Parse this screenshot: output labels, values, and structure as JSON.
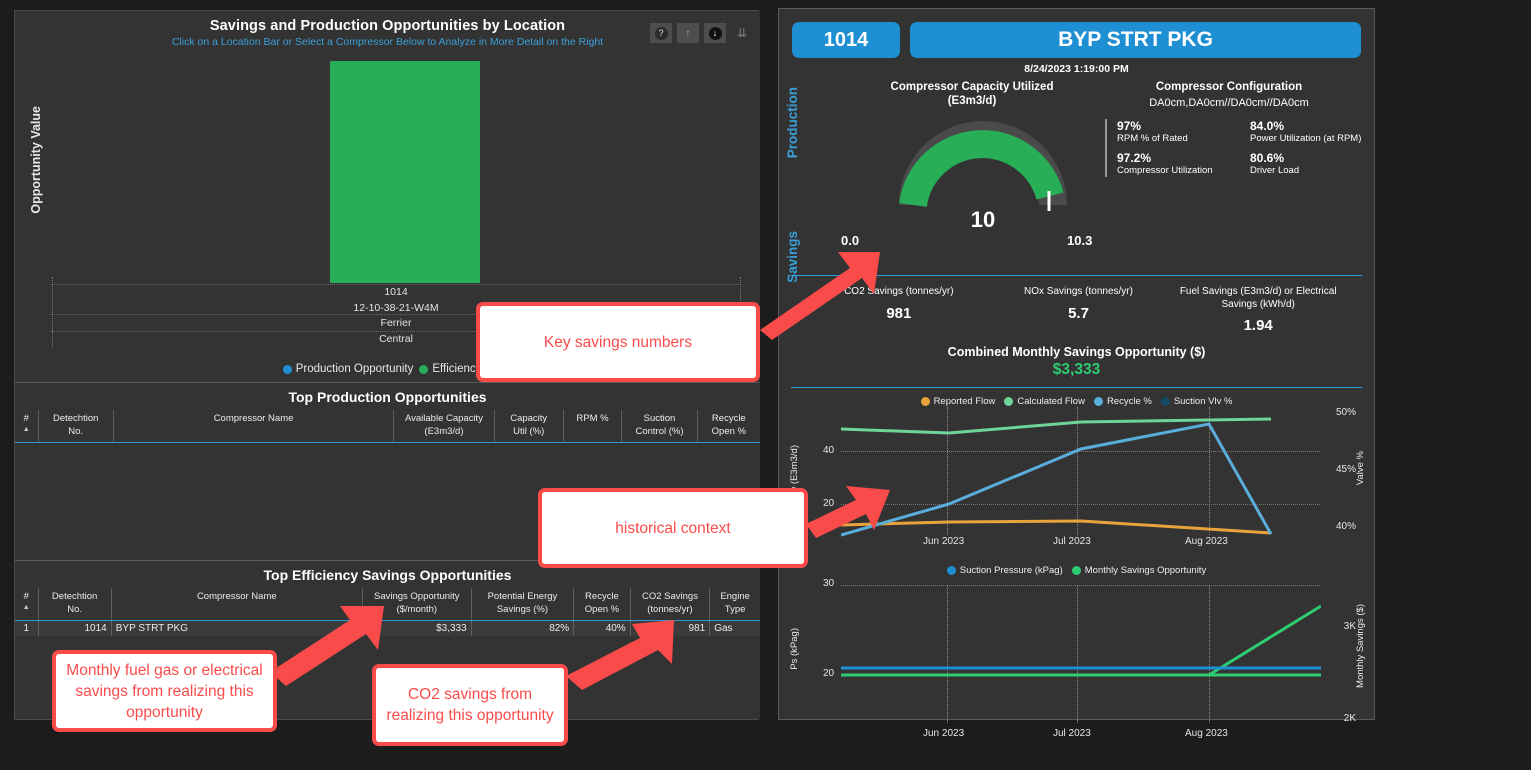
{
  "left_panel": {
    "chart_title": "Savings and Production Opportunities by Location",
    "chart_subtitle": "Click on a Location Bar or Select a Compressor Below to Analyze in More Detail on the Right",
    "y_axis_label": "Opportunity Value",
    "toolbar": {
      "help_icon": "help-icon",
      "up_icon": "arrow-up-icon",
      "down_icon": "arrow-down-filled-icon",
      "drill_icon": "double-arrow-down-icon"
    },
    "legend": [
      {
        "label": "Production Opportunity",
        "color": "#1f8fd4"
      },
      {
        "label": "Efficiency S",
        "color": "#27ae57"
      }
    ]
  },
  "chart_data": [
    {
      "type": "bar",
      "title": "Savings and Production Opportunities by Location",
      "subtitle": "Click on a Location Bar or Select a Compressor Below to Analyze in More Detail on the Right",
      "ylabel": "Opportunity Value",
      "xlabel": "",
      "categories": [
        "1014"
      ],
      "category_hierarchy": [
        "1014",
        "12-10-38-21-W4M",
        "Ferrier",
        "Central"
      ],
      "series": [
        {
          "name": "Production Opportunity",
          "color": "#1f8fd4",
          "values": [
            0
          ]
        },
        {
          "name": "Efficiency Savings",
          "color": "#27ae57",
          "values": [
            3333
          ]
        }
      ],
      "grid": true,
      "legend_position": "bottom"
    },
    {
      "type": "line",
      "title": "",
      "xlabel": "",
      "ylabel": "Flow (E3m3/d)",
      "y2label": "Valve %",
      "x": [
        "Jun 2023",
        "Jul 2023",
        "Aug 2023"
      ],
      "xtick_labels": [
        "Jun 2023",
        "Jul 2023",
        "Aug 2023"
      ],
      "ytick_labels": [
        "20",
        "40"
      ],
      "y2tick_labels": [
        "40%",
        "45%",
        "50%"
      ],
      "ylim": [
        0,
        50
      ],
      "y2lim": [
        38.5,
        51
      ],
      "series": [
        {
          "name": "Reported Flow",
          "color": "#e8a33d",
          "axis": "left",
          "values": [
            12.5,
            12.6,
            12.3,
            10.4
          ]
        },
        {
          "name": "Calculated Flow",
          "color": "#6fd49a",
          "axis": "left",
          "values": [
            45.5,
            45.0,
            46.5,
            47.0
          ]
        },
        {
          "name": "Recycle %",
          "color": "#5aaedb",
          "axis": "right",
          "values": [
            39.7,
            41.3,
            45.6,
            40.0
          ]
        },
        {
          "name": "Suction Vlv %",
          "color": "#124a63",
          "axis": "right",
          "values": []
        }
      ],
      "grid": true,
      "legend_position": "top"
    },
    {
      "type": "line",
      "title": "",
      "xlabel": "",
      "ylabel": "Ps (kPag)",
      "y2label": "Monthly Savings ($)",
      "x": [
        "Jun 2023",
        "Jul 2023",
        "Aug 2023"
      ],
      "xtick_labels": [
        "Jun 2023",
        "Jul 2023",
        "Aug 2023"
      ],
      "ytick_labels": [
        "20",
        "30"
      ],
      "y2tick_labels": [
        "2K",
        "3K"
      ],
      "ylim": [
        15,
        31
      ],
      "y2lim": [
        1900,
        3500
      ],
      "series": [
        {
          "name": "Suction Pressure (kPag)",
          "color": "#1f8fd4",
          "axis": "left",
          "values": [
            20.6,
            20.6,
            20.6,
            20.6
          ]
        },
        {
          "name": "Monthly Savings Opportunity",
          "color": "#2ecc71",
          "axis": "right",
          "values": [
            2000,
            2000,
            2000,
            3333
          ]
        }
      ],
      "grid": true,
      "legend_position": "top"
    }
  ],
  "production_table": {
    "title": "Top Production Opportunities",
    "columns": [
      "#",
      "Detechtion No.",
      "Compressor Name",
      "Available Capacity (E3m3/d)",
      "Capacity Util (%)",
      "RPM %",
      "Suction Control (%)",
      "Recycle Open %"
    ],
    "columns_split": [
      [
        "#",
        ""
      ],
      [
        "Detechtion",
        "No."
      ],
      [
        "Compressor Name",
        ""
      ],
      [
        "Available Capacity",
        "(E3m3/d)"
      ],
      [
        "Capacity",
        "Util (%)"
      ],
      [
        "RPM %",
        ""
      ],
      [
        "Suction",
        "Control (%)"
      ],
      [
        "Recycle",
        "Open %"
      ]
    ],
    "rows": []
  },
  "efficiency_table": {
    "title": "Top Efficiency Savings Opportunities",
    "columns_split": [
      [
        "#",
        ""
      ],
      [
        "Detechtion",
        "No."
      ],
      [
        "Compressor Name",
        ""
      ],
      [
        "Savings Opportunity",
        "($/month)"
      ],
      [
        "Potential Energy",
        "Savings (%)"
      ],
      [
        "Recycle",
        "Open %"
      ],
      [
        "CO2 Savings",
        "(tonnes/yr)"
      ],
      [
        "Engine",
        "Type"
      ]
    ],
    "rows": [
      {
        "index": "1",
        "detechtion_no": "1014",
        "compressor_name": "BYP STRT PKG",
        "savings_opportunity": "$3,333",
        "potential_energy_savings": "82%",
        "recycle_open": "40%",
        "co2_savings": "981",
        "engine_type": "Gas"
      }
    ]
  },
  "right_panel": {
    "id_pill": "1014",
    "name_pill": "BYP STRT PKG",
    "timestamp": "8/24/2023 1:19:00 PM",
    "section_production": "Production",
    "section_savings": "Savings",
    "gauge": {
      "title_line1": "Compressor Capacity Utilized",
      "title_line2": "(E3m3/d)",
      "min": "0.0",
      "max": "10.3",
      "value": "10",
      "color": "#27ae57"
    },
    "configuration": {
      "title": "Compressor Configuration",
      "value": "DA0cm,DA0cm//DA0cm//DA0cm",
      "metrics": [
        {
          "value": "97%",
          "label": "RPM % of Rated"
        },
        {
          "value": "84.0%",
          "label": "Power Utilization (at RPM)"
        },
        {
          "value": "97.2%",
          "label": "Compressor Utilization"
        },
        {
          "value": "80.6%",
          "label": "Driver Load"
        }
      ]
    },
    "savings": {
      "cells": [
        {
          "label": "CO2 Savings (tonnes/yr)",
          "value": "981"
        },
        {
          "label": "NOx Savings (tonnes/yr)",
          "value": "5.7"
        },
        {
          "label": "Fuel Savings (E3m3/d) or Electrical Savings (kWh/d)",
          "value": "1.94"
        }
      ],
      "combined_label": "Combined Monthly Savings Opportunity ($)",
      "combined_value": "$3,333",
      "combined_color": "#2ecc71"
    },
    "chart1_legend": [
      {
        "label": "Reported Flow",
        "color": "#e8a33d"
      },
      {
        "label": "Calculated Flow",
        "color": "#6fd49a"
      },
      {
        "label": "Recycle %",
        "color": "#5aaedb"
      },
      {
        "label": "Suction Vlv %",
        "color": "#124a63"
      }
    ],
    "chart2_legend": [
      {
        "label": "Suction Pressure (kPag)",
        "color": "#1f8fd4"
      },
      {
        "label": "Monthly Savings Opportunity",
        "color": "#2ecc71"
      }
    ]
  },
  "annotations": [
    {
      "text": "Key savings numbers"
    },
    {
      "text": "historical context"
    },
    {
      "text": "Monthly fuel gas or electrical savings from realizing this opportunity"
    },
    {
      "text": "CO2 savings from realizing this opportunity"
    }
  ],
  "colors": {
    "accent_blue": "#1f8fd4",
    "green": "#27ae57",
    "annotation_red": "#fa4b4b",
    "panel_bg": "#333333",
    "page_bg": "#1c1c1c"
  }
}
